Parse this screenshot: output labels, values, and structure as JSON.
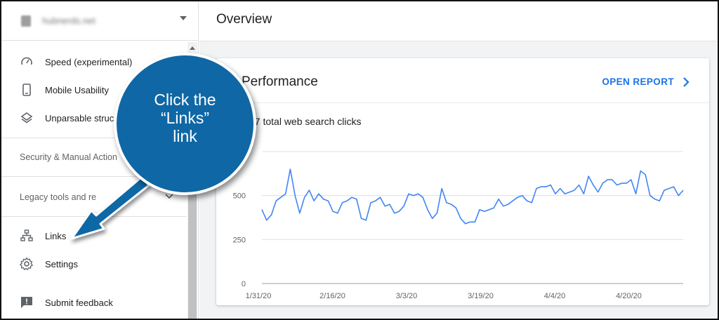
{
  "property": {
    "name": "hubnerds.net"
  },
  "sidebar": {
    "items": [
      {
        "label": "Speed (experimental)",
        "icon": "speedometer-icon"
      },
      {
        "label": "Mobile Usability",
        "icon": "phone-icon"
      },
      {
        "label": "Unparsable struc",
        "icon": "layers-icon"
      }
    ],
    "security_section": "Security & Manual Action",
    "legacy_section": "Legacy tools and re",
    "links": {
      "label": "Links",
      "icon": "sitemap-icon"
    },
    "settings": {
      "label": "Settings",
      "icon": "gear-icon"
    },
    "feedback": {
      "label": "Submit feedback",
      "icon": "feedback-icon"
    }
  },
  "header": {
    "title": "Overview"
  },
  "card": {
    "title": "Performance",
    "open_report": "OPEN REPORT",
    "clicks_text": "17 total web search clicks"
  },
  "callout": {
    "line1": "Click the",
    "line2": "“Links”",
    "line3": "link"
  },
  "colors": {
    "accent": "#1a73e8",
    "callout": "#0f67a5",
    "line": "#4285f4"
  },
  "chart_data": {
    "type": "line",
    "y_ticks": [
      0,
      250,
      500
    ],
    "x_ticks": [
      "1/31/20",
      "2/16/20",
      "3/3/20",
      "3/19/20",
      "4/4/20",
      "4/20/20"
    ],
    "ylim": [
      0,
      750
    ],
    "grid": true,
    "series": [
      {
        "values": [
          420,
          360,
          390,
          470,
          490,
          510,
          650,
          500,
          400,
          490,
          530,
          470,
          510,
          480,
          470,
          410,
          400,
          460,
          470,
          490,
          480,
          370,
          360,
          460,
          470,
          490,
          440,
          450,
          400,
          410,
          440,
          510,
          500,
          510,
          490,
          420,
          370,
          400,
          540,
          460,
          450,
          430,
          370,
          340,
          350,
          350,
          420,
          410,
          420,
          430,
          480,
          440,
          450,
          470,
          490,
          500,
          470,
          460,
          540,
          550,
          550,
          560,
          510,
          540,
          510,
          520,
          530,
          560,
          510,
          610,
          560,
          520,
          570,
          590,
          590,
          560,
          570,
          570,
          590,
          510,
          640,
          620,
          500,
          480,
          470,
          530,
          540,
          550,
          500,
          530
        ]
      }
    ]
  }
}
